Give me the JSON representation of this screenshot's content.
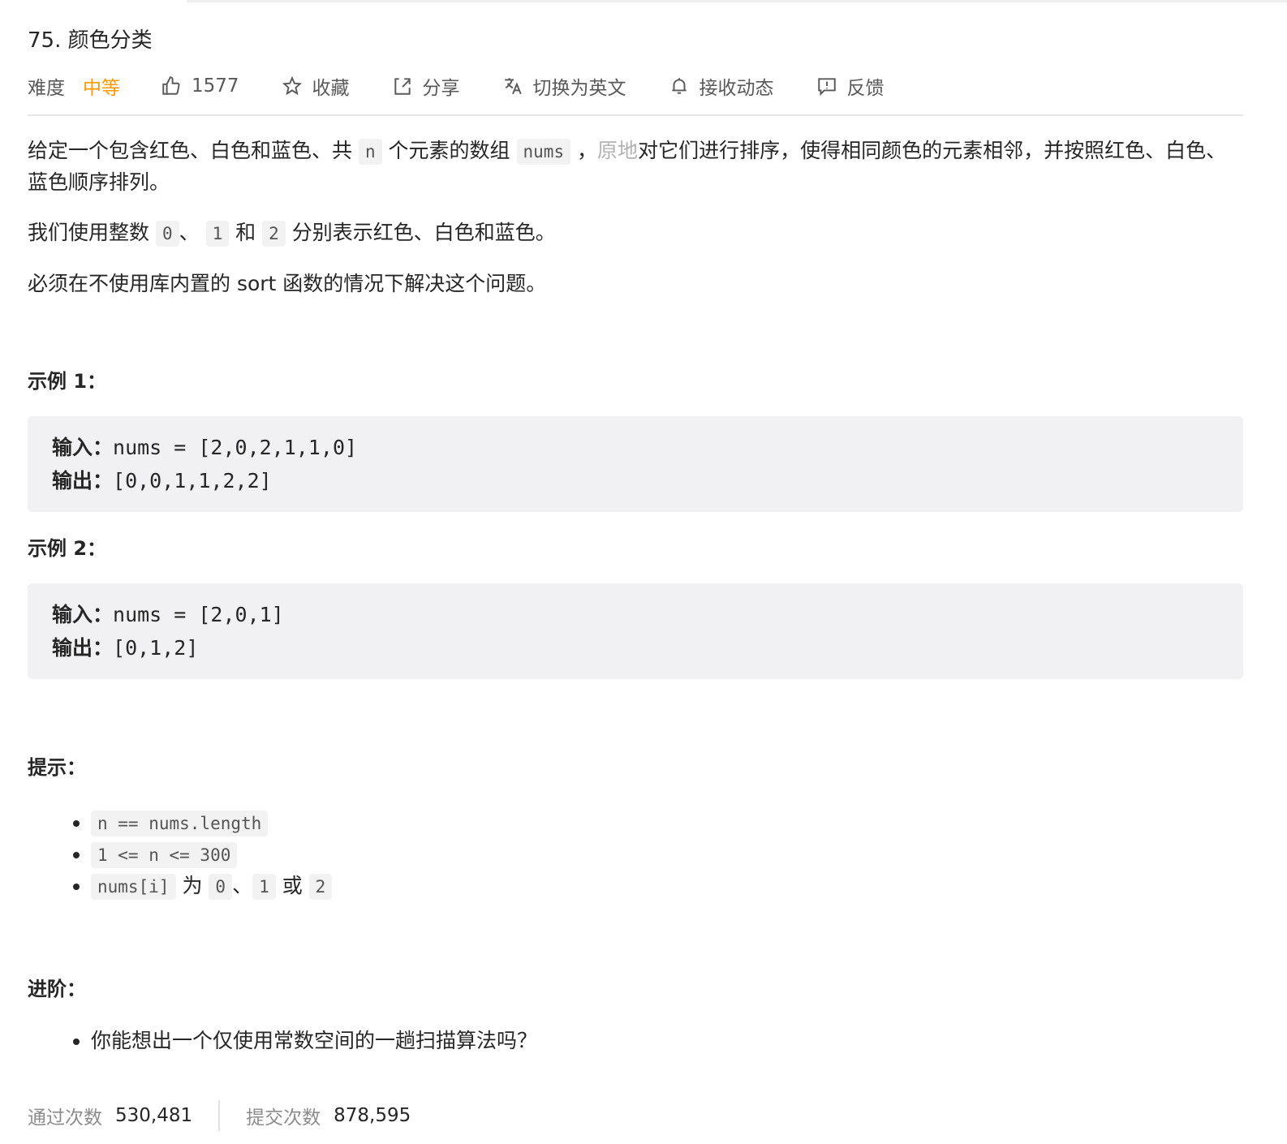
{
  "problem": {
    "title": "75. 颜色分类",
    "difficulty_label": "难度",
    "difficulty_value": "中等",
    "likes": "1577",
    "favorite_label": "收藏",
    "share_label": "分享",
    "switch_lang_label": "切换为英文",
    "subscribe_label": "接收动态",
    "feedback_label": "反馈",
    "colors": {
      "difficulty_medium": "#ff9800"
    }
  },
  "description": {
    "p1_a": "给定一个包含红色、白色和蓝色、共 ",
    "p1_code_n": "n",
    "p1_b": " 个元素的数组 ",
    "p1_code_nums": "nums",
    "p1_c": " ，",
    "p1_link": "原地",
    "p1_d": "对它们进行排序，使得相同颜色的元素相邻，并按照红色、白色、蓝色顺序排列。",
    "p2_a": "我们使用整数 ",
    "p2_code_0": "0",
    "p2_b": "、 ",
    "p2_code_1": "1",
    "p2_c": " 和 ",
    "p2_code_2": "2",
    "p2_d": " 分别表示红色、白色和蓝色。",
    "p3": "必须在不使用库内置的 sort 函数的情况下解决这个问题。"
  },
  "examples": [
    {
      "title": "示例 1：",
      "input_label": "输入：",
      "input_value": "nums = [2,0,2,1,1,0]",
      "output_label": "输出：",
      "output_value": "[0,0,1,1,2,2]"
    },
    {
      "title": "示例 2：",
      "input_label": "输入：",
      "input_value": "nums = [2,0,1]",
      "output_label": "输出：",
      "output_value": "[0,1,2]"
    }
  ],
  "hints": {
    "title": "提示：",
    "item1_code": "n == nums.length",
    "item2_code": "1 <= n <= 300",
    "item3_code_a": "nums[i]",
    "item3_text_a": " 为 ",
    "item3_code_b": "0",
    "item3_text_b": "、",
    "item3_code_c": "1",
    "item3_text_c": " 或 ",
    "item3_code_d": "2"
  },
  "advanced": {
    "title": "进阶：",
    "item1": "你能想出一个仅使用常数空间的一趟扫描算法吗？"
  },
  "stats": {
    "accepted_label": "通过次数",
    "accepted_value": "530,481",
    "submissions_label": "提交次数",
    "submissions_value": "878,595"
  }
}
